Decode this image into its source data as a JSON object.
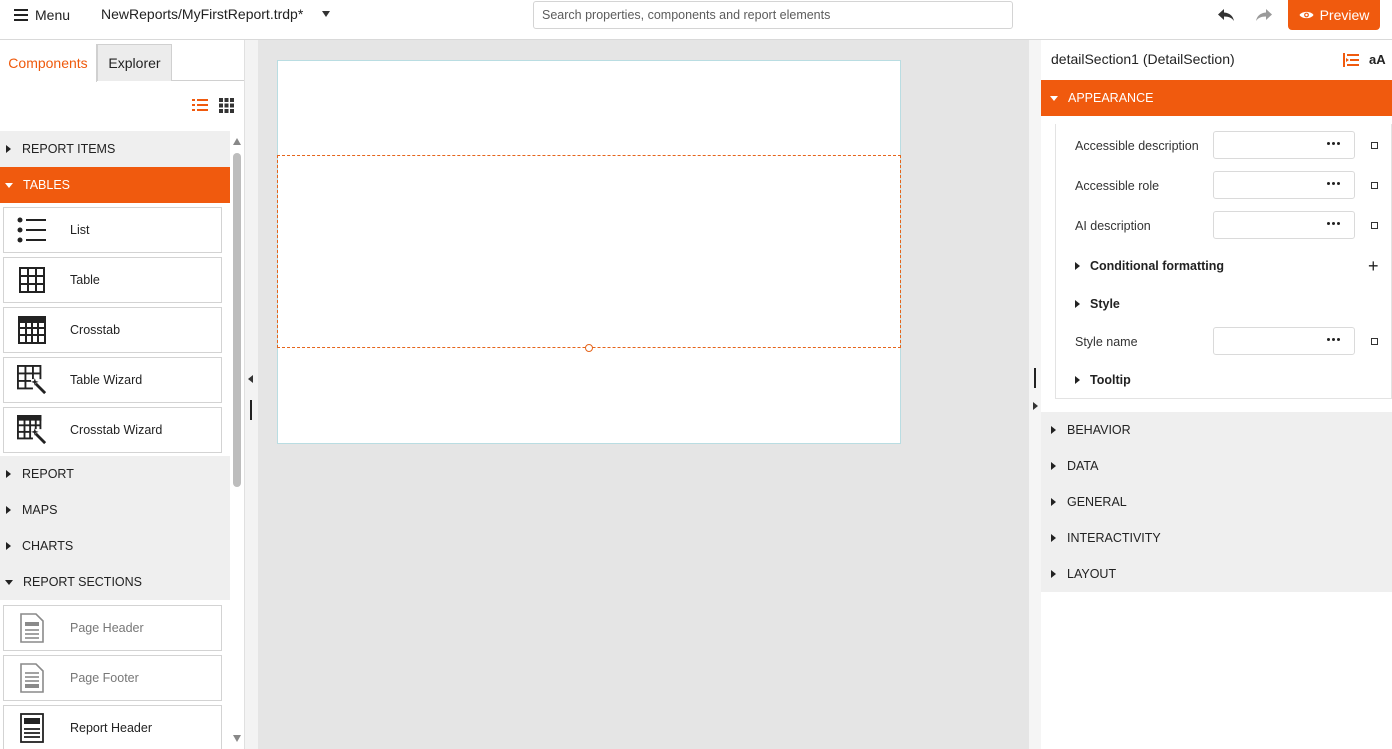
{
  "topbar": {
    "menu_label": "Menu",
    "doc_title": "NewReports/MyFirstReport.trdp*",
    "search_placeholder": "Search properties, components and report elements",
    "preview_label": "Preview"
  },
  "left": {
    "tabs": [
      "Components",
      "Explorer"
    ],
    "groups": {
      "report_items": "REPORT ITEMS",
      "tables": "TABLES",
      "report": "REPORT",
      "maps": "MAPS",
      "charts": "CHARTS",
      "report_sections": "REPORT SECTIONS"
    },
    "table_items": [
      "List",
      "Table",
      "Crosstab",
      "Table Wizard",
      "Crosstab Wizard"
    ],
    "section_items": [
      "Page Header",
      "Page Footer",
      "Report Header"
    ]
  },
  "right": {
    "title": "detailSection1 (DetailSection)",
    "text_size_label": "aA",
    "categories": {
      "appearance": "APPEARANCE",
      "behavior": "BEHAVIOR",
      "data": "DATA",
      "general": "GENERAL",
      "interactivity": "INTERACTIVITY",
      "layout": "LAYOUT"
    },
    "props": {
      "accessible_description": "Accessible description",
      "accessible_role": "Accessible role",
      "ai_description": "AI description",
      "conditional_formatting": "Conditional formatting",
      "style": "Style",
      "style_name": "Style name",
      "tooltip": "Tooltip"
    }
  },
  "colors": {
    "accent": "#f05a0e",
    "panel_gray": "#efefef",
    "canvas_bg": "#e5e5e5"
  }
}
